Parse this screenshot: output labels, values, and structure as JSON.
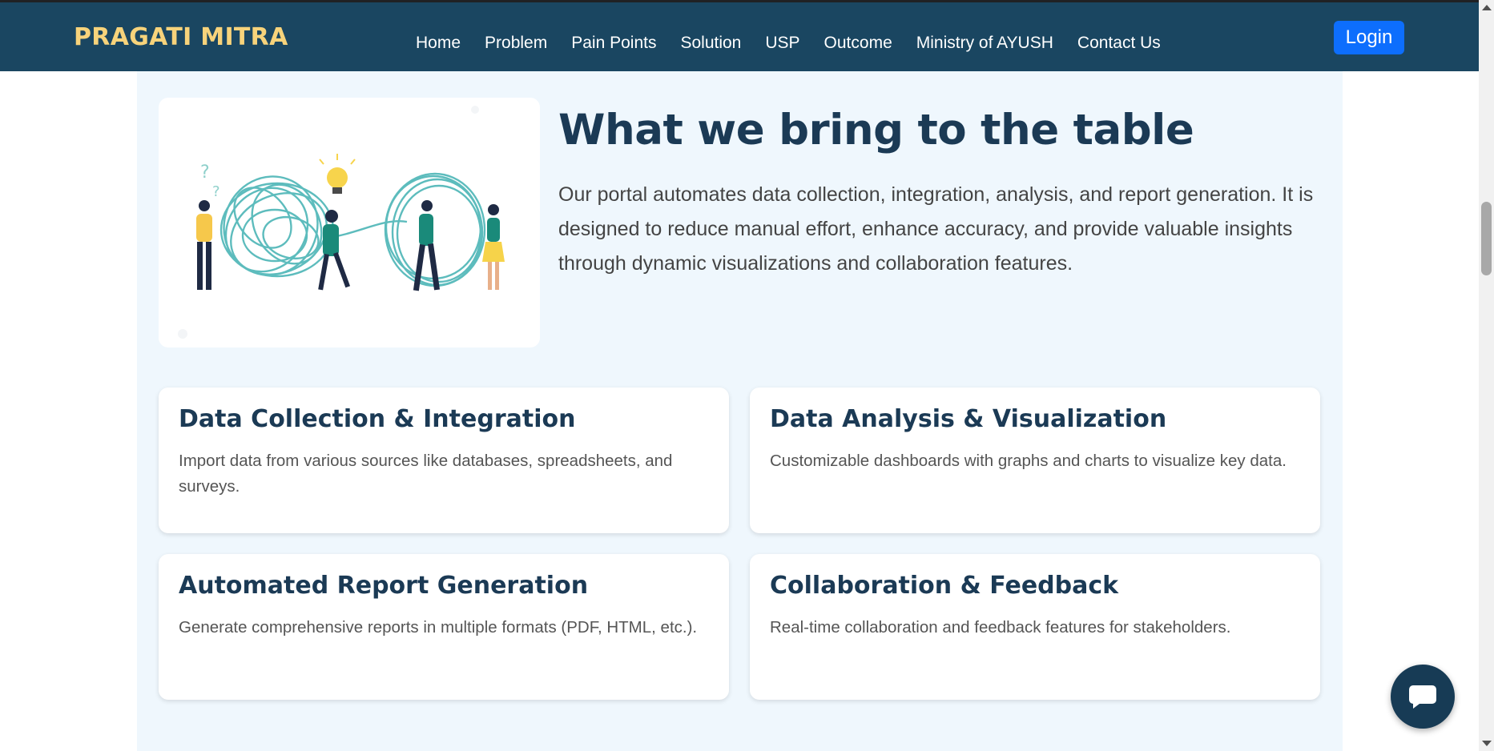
{
  "brand": "PRAGATI MITRA",
  "nav": {
    "items": [
      {
        "label": "Home"
      },
      {
        "label": "Problem"
      },
      {
        "label": "Pain Points"
      },
      {
        "label": "Solution"
      },
      {
        "label": "USP"
      },
      {
        "label": "Outcome"
      },
      {
        "label": "Ministry of AYUSH"
      },
      {
        "label": "Contact Us"
      }
    ],
    "login_label": "Login"
  },
  "hero": {
    "title": "What we bring to the table",
    "text": "Our portal automates data collection, integration, analysis, and report generation. It is designed to reduce manual effort, enhance accuracy, and provide valuable insights through dynamic visualizations and collaboration features."
  },
  "cards": [
    {
      "title": "Data Collection & Integration",
      "text": "Import data from various sources like databases, spreadsheets, and surveys."
    },
    {
      "title": "Data Analysis & Visualization",
      "text": "Customizable dashboards with graphs and charts to visualize key data."
    },
    {
      "title": "Automated Report Generation",
      "text": "Generate comprehensive reports in multiple formats (PDF, HTML, etc.)."
    },
    {
      "title": "Collaboration & Feedback",
      "text": "Real-time collaboration and feedback features for stakeholders."
    }
  ],
  "colors": {
    "navbar": "#1a4661",
    "brand": "#f7d37b",
    "login": "#0d6efd",
    "section_bg": "#eff7fd",
    "heading": "#1b3a55",
    "chat": "#173b55"
  },
  "icons": {
    "chat": "chat-bubble-icon",
    "illustration": "tangled-thread-illustration"
  }
}
